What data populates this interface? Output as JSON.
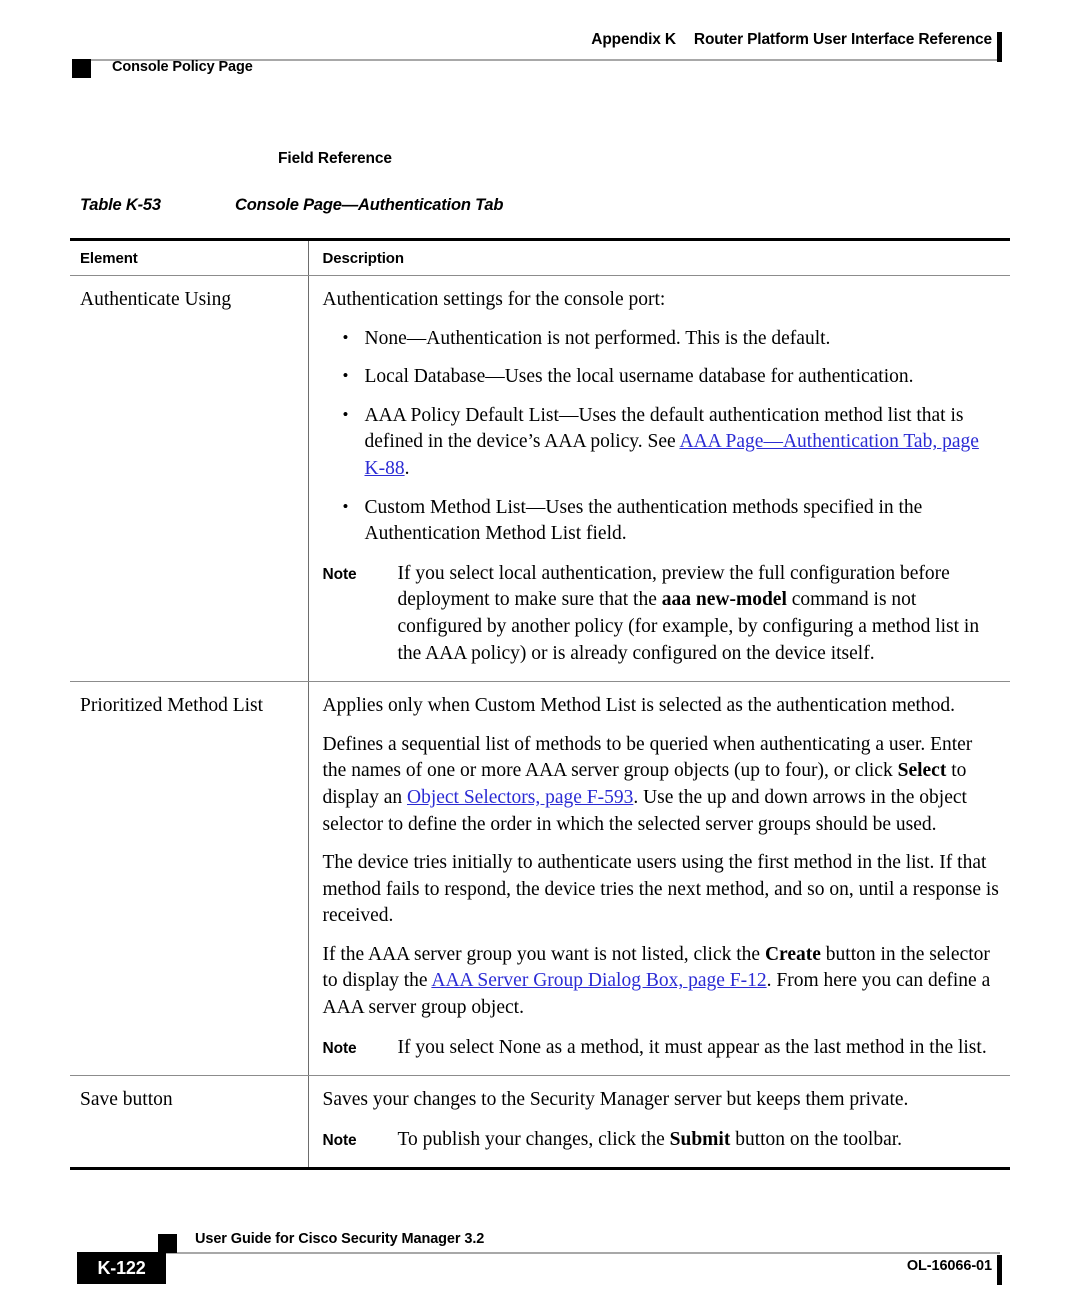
{
  "header": {
    "appendix_label": "Appendix K",
    "appendix_title": "Router Platform User Interface Reference",
    "section_title": "Console Policy Page"
  },
  "body": {
    "field_reference_heading": "Field Reference",
    "table_caption_number": "Table K-53",
    "table_caption_title": "Console Page—Authentication Tab"
  },
  "table": {
    "columns": [
      "Element",
      "Description"
    ],
    "rows": [
      {
        "element": "Authenticate Using",
        "intro": "Authentication settings for the console port:",
        "bullets": [
          {
            "text": "None—Authentication is not performed. This is the default."
          },
          {
            "text": "Local Database—Uses the local username database for authentication."
          },
          {
            "pre": "AAA Policy Default List—Uses the default authentication method list that is defined in the device’s AAA policy. See ",
            "link": "AAA Page—Authentication Tab, page K-88",
            "post": "."
          },
          {
            "text": "Custom Method List—Uses the authentication methods specified in the Authentication Method List field."
          }
        ],
        "note_label": "Note",
        "note_pre": "If you select local authentication, preview the full configuration before deployment to make sure that the ",
        "note_bold": "aaa new-model",
        "note_post": " command is not configured by another policy (for example, by configuring a method list in the AAA policy) or is already configured on the device itself."
      },
      {
        "element": "Prioritized Method List",
        "para1": "Applies only when Custom Method List is selected as the authentication method.",
        "para2_a": "Defines a sequential list of methods to be queried when authenticating a user. Enter the names of one or more AAA server group objects (up to four), or click ",
        "para2_bold": "Select",
        "para2_b": " to display an ",
        "para2_link": "Object Selectors, page F-593",
        "para2_c": ". Use the up and down arrows in the object selector to define the order in which the selected server groups should be used.",
        "para3": "The device tries initially to authenticate users using the first method in the list. If that method fails to respond, the device tries the next method, and so on, until a response is received.",
        "para4_a": "If the AAA server group you want is not listed, click the ",
        "para4_bold": "Create",
        "para4_b": " button in the selector to display the ",
        "para4_link": "AAA Server Group Dialog Box, page F-12",
        "para4_c": ". From here you can define a AAA server group object.",
        "note_label": "Note",
        "note_text": "If you select None as a method, it must appear as the last method in the list."
      },
      {
        "element": "Save button",
        "para1": "Saves your changes to the Security Manager server but keeps them private.",
        "note_label": "Note",
        "note_pre": "To publish your changes, click the ",
        "note_bold": "Submit",
        "note_post": " button on the toolbar."
      }
    ]
  },
  "footer": {
    "page_number": "K-122",
    "guide_title": "User Guide for Cisco Security Manager 3.2",
    "doc_id": "OL-16066-01"
  },
  "colors": {
    "link": "#2b2bd4",
    "rule": "#a8a8a8",
    "table_border": "#8c8c8c"
  }
}
